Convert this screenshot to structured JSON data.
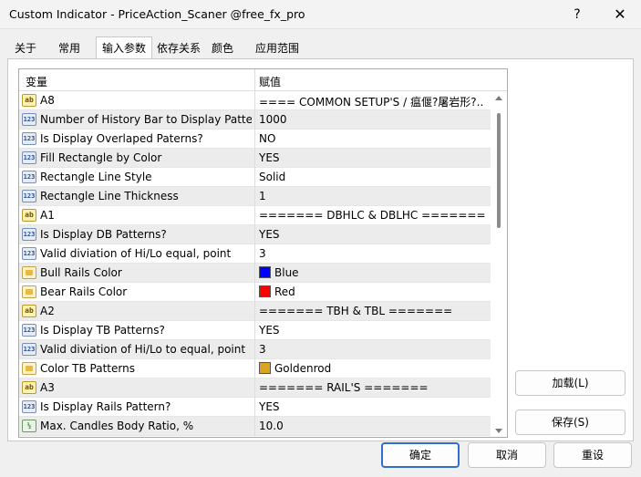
{
  "window": {
    "title": "Custom Indicator - PriceAction_Scaner @free_fx_pro",
    "help": "?",
    "close": "✕"
  },
  "tabs": [
    {
      "label": "关于",
      "active": false
    },
    {
      "label": "常用",
      "active": false
    },
    {
      "label": "输入参数",
      "active": true
    },
    {
      "label": "依存关系",
      "active": false
    },
    {
      "label": "颜色",
      "active": false
    },
    {
      "label": "应用范围",
      "active": false
    }
  ],
  "grid": {
    "col_variable": "变量",
    "col_value": "赋值",
    "rows": [
      {
        "icon": "ab",
        "icon_name": "string-icon",
        "name": "A8",
        "value": "==== COMMON SETUP'S / 瘟偃?屠岩形?.."
      },
      {
        "icon": "123",
        "icon_name": "integer-icon",
        "name": "Number of History Bar to Display Patte...",
        "value": "1000"
      },
      {
        "icon": "123",
        "icon_name": "integer-icon",
        "name": "Is Display Overlaped Paterns?",
        "value": "NO"
      },
      {
        "icon": "123",
        "icon_name": "integer-icon",
        "name": "Fill Rectangle by Color",
        "value": "YES"
      },
      {
        "icon": "123",
        "icon_name": "integer-icon",
        "name": "Rectangle Line Style",
        "value": "Solid"
      },
      {
        "icon": "123",
        "icon_name": "integer-icon",
        "name": "Rectangle Line Thickness",
        "value": "1"
      },
      {
        "icon": "ab",
        "icon_name": "string-icon",
        "name": "A1",
        "value": "======= DBHLC & DBLHC ======="
      },
      {
        "icon": "123",
        "icon_name": "integer-icon",
        "name": "Is Display DB Patterns?",
        "value": "YES"
      },
      {
        "icon": "123",
        "icon_name": "integer-icon",
        "name": "Valid diviation of Hi/Lo equal, point",
        "value": "3"
      },
      {
        "icon": "clr",
        "icon_name": "color-icon",
        "name": "Bull Rails Color",
        "value": "Blue",
        "swatch": "#0000ff"
      },
      {
        "icon": "clr",
        "icon_name": "color-icon",
        "name": "Bear Rails Color",
        "value": "Red",
        "swatch": "#ff0000"
      },
      {
        "icon": "ab",
        "icon_name": "string-icon",
        "name": "A2",
        "value": "======= TBH & TBL ======="
      },
      {
        "icon": "123",
        "icon_name": "integer-icon",
        "name": "Is Display TB Patterns?",
        "value": "YES"
      },
      {
        "icon": "123",
        "icon_name": "integer-icon",
        "name": "Valid diviation of Hi/Lo to equal, point",
        "value": "3"
      },
      {
        "icon": "clr",
        "icon_name": "color-icon",
        "name": "Color TB Patterns",
        "value": "Goldenrod",
        "swatch": "#daa520"
      },
      {
        "icon": "ab",
        "icon_name": "string-icon",
        "name": "A3",
        "value": "======= RAIL'S ======="
      },
      {
        "icon": "123",
        "icon_name": "integer-icon",
        "name": "Is Display Rails Pattern?",
        "value": "YES"
      },
      {
        "icon": "½",
        "icon_name": "double-icon",
        "name": "Max. Candles Body Ratio, %",
        "value": "10.0"
      }
    ]
  },
  "buttons": {
    "load": "加载(L)",
    "save": "保存(S)",
    "ok": "确定",
    "cancel": "取消",
    "reset": "重设"
  }
}
